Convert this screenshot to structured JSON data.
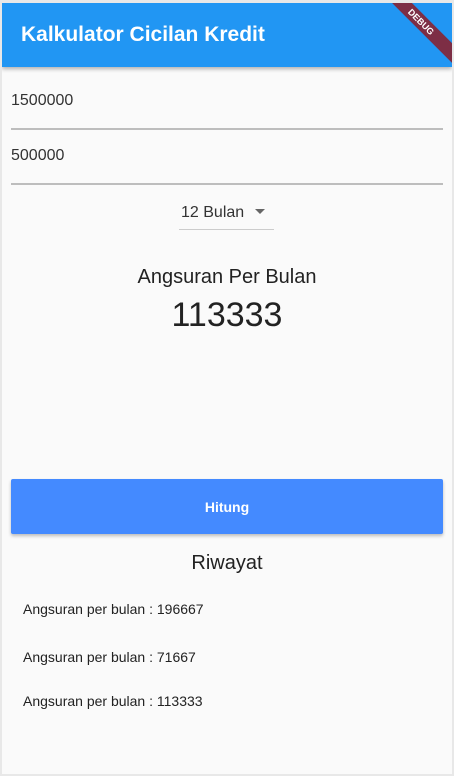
{
  "appbar": {
    "title": "Kalkulator Cicilan Kredit",
    "debug_banner": "DEBUG",
    "color": "#2196f3"
  },
  "form": {
    "price": "1500000",
    "down_payment": "500000",
    "tenor": "12 Bulan"
  },
  "result": {
    "label": "Angsuran Per Bulan",
    "value": "113333"
  },
  "button": {
    "label": "Hitung",
    "color": "#448aff"
  },
  "history": {
    "title": "Riwayat",
    "items": [
      "Angsuran per bulan : 196667",
      "Angsuran per bulan : 71667",
      "Angsuran per bulan : 113333"
    ]
  }
}
